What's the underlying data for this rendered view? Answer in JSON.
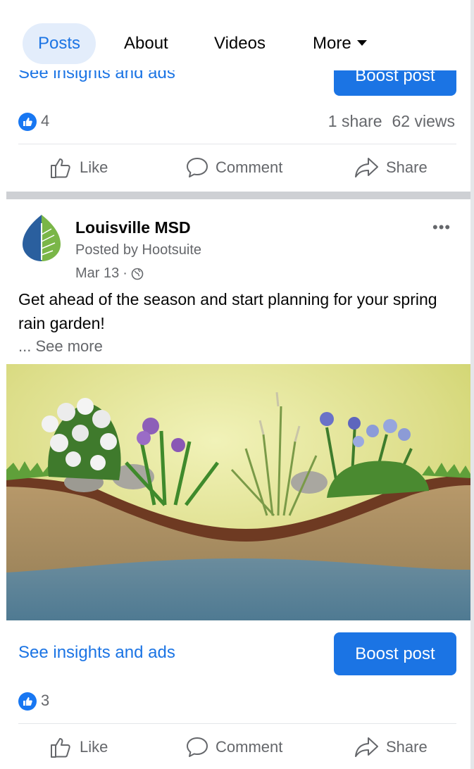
{
  "tabs": {
    "posts": "Posts",
    "about": "About",
    "videos": "Videos",
    "more": "More"
  },
  "previous_post": {
    "insights_label": "See insights and ads",
    "boost_label": "Boost post",
    "like_count": "4",
    "shares": "1 share",
    "views": "62 views",
    "actions": {
      "like": "Like",
      "comment": "Comment",
      "share": "Share"
    }
  },
  "post": {
    "author": "Louisville MSD",
    "posted_by": "Posted by Hootsuite",
    "date": "Mar 13",
    "date_separator": "·",
    "more_menu": "•••",
    "text": "Get ahead of the season and start planning for your spring rain garden!",
    "see_more": "... See more",
    "image_icon": "rain-garden-illustration",
    "insights_label": "See insights and ads",
    "boost_label": "Boost post",
    "like_count": "3",
    "actions": {
      "like": "Like",
      "comment": "Comment",
      "share": "Share"
    }
  },
  "colors": {
    "accent": "#1b74e4",
    "like_badge": "#1877f2",
    "muted": "#65676b",
    "separator": "#ced0d4"
  }
}
